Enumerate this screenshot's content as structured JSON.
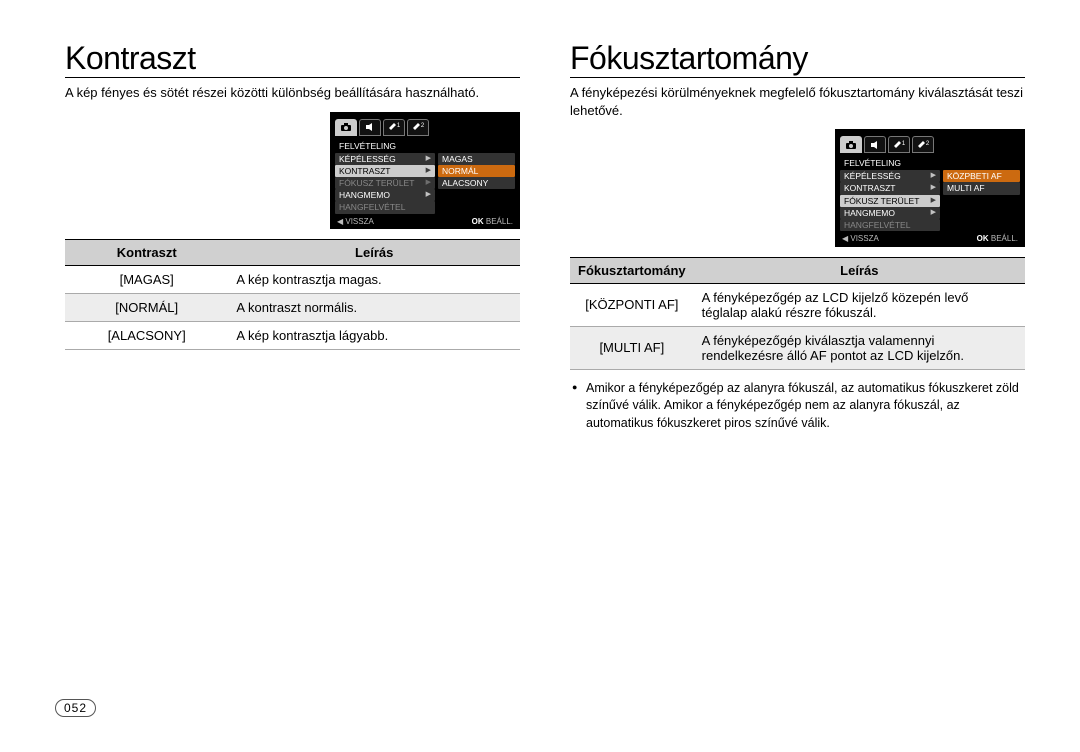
{
  "page_number": "052",
  "left": {
    "title": "Kontraszt",
    "intro": "A kép fényes és sötét részei közötti különbség beállítására használható.",
    "lcd": {
      "section": "FELVÉTELING",
      "tabs_extra": [
        "1",
        "2"
      ],
      "rows_left": [
        {
          "label": "KÉPÉLESSÉG",
          "style": "dk",
          "arrow": true
        },
        {
          "label": "KONTRASZT",
          "style": "lt",
          "arrow": true
        },
        {
          "label": "FÓKUSZ TERÜLET",
          "style": "dk",
          "arrow": true,
          "dim": true
        },
        {
          "label": "HANGMEMO",
          "style": "dk",
          "arrow": true
        },
        {
          "label": "HANGFELVÉTEL",
          "style": "dk",
          "arrow": false,
          "dim": true
        }
      ],
      "rows_right": [
        {
          "label": "MAGAS",
          "style": "dk"
        },
        {
          "label": "NORMÁL",
          "style": "or"
        },
        {
          "label": "ALACSONY",
          "style": "dk"
        }
      ],
      "footer_left": "VISSZA",
      "footer_right_ok": "OK",
      "footer_right": "BEÁLL."
    },
    "table": {
      "headers": [
        "Kontraszt",
        "Leírás"
      ],
      "rows": [
        {
          "opt": "[MAGAS]",
          "desc": "A kép kontrasztja magas."
        },
        {
          "opt": "[NORMÁL]",
          "desc": "A kontraszt normális."
        },
        {
          "opt": "[ALACSONY]",
          "desc": "A kép kontrasztja lágyabb."
        }
      ]
    }
  },
  "right": {
    "title": "Fókusztartomány",
    "intro": "A fényképezési körülményeknek megfelelő fókusztartomány kiválasztását teszi lehetővé.",
    "lcd": {
      "section": "FELVÉTELING",
      "tabs_extra": [
        "1",
        "2"
      ],
      "rows_left": [
        {
          "label": "KÉPÉLESSÉG",
          "style": "dk",
          "arrow": true
        },
        {
          "label": "KONTRASZT",
          "style": "dk",
          "arrow": true
        },
        {
          "label": "FÓKUSZ TERÜLET",
          "style": "lt",
          "arrow": true
        },
        {
          "label": "HANGMEMO",
          "style": "dk",
          "arrow": true
        },
        {
          "label": "HANGFELVÉTEL",
          "style": "dk",
          "arrow": false,
          "dim": true
        }
      ],
      "rows_right": [
        {
          "label": "KÖZPBETI AF",
          "style": "or"
        },
        {
          "label": "MULTI AF",
          "style": "dk"
        }
      ],
      "footer_left": "VISSZA",
      "footer_right_ok": "OK",
      "footer_right": "BEÁLL."
    },
    "table": {
      "headers": [
        "Fókusztartomány",
        "Leírás"
      ],
      "rows": [
        {
          "opt": "[KÖZPONTI AF]",
          "desc": "A fényképezőgép az LCD kijelző közepén levő téglalap alakú részre fókuszál."
        },
        {
          "opt": "[MULTI AF]",
          "desc": "A fényképezőgép kiválasztja valamennyi rendelkezésre álló AF pontot az LCD kijelzőn."
        }
      ]
    },
    "bullet": "Amikor a fényképezőgép az alanyra fókuszál, az automatikus fókuszkeret zöld színűvé válik. Amikor a fényképezőgép nem az alanyra fókuszál, az automatikus fókuszkeret piros színűvé válik."
  }
}
